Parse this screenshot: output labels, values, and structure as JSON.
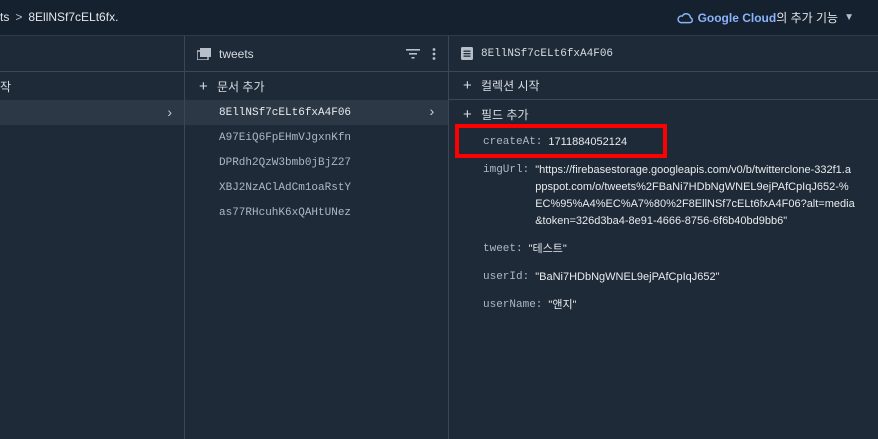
{
  "breadcrumb": {
    "part1": "ts",
    "part2": "8EllNSf7cELt6fx."
  },
  "topbar": {
    "brand": "Google Cloud",
    "suffix": "의 추가 기능"
  },
  "panel1": {
    "add_label": "작"
  },
  "panel2": {
    "title": "tweets",
    "add_label": "문서 추가",
    "documents": [
      "8EllNSf7cELt6fxA4F06",
      "A97EiQ6FpEHmVJgxnKfn",
      "DPRdh2QzW3bmb0jBjZ27",
      "XBJ2NzAClAdCm1oaRstY",
      "as77RHcuhK6xQAHtUNez"
    ]
  },
  "panel3": {
    "title": "8EllNSf7cELt6fxA4F06",
    "add_collection": "컬렉션 시작",
    "add_field": "필드 추가",
    "fields": [
      {
        "key": "createAt:",
        "value": "1711884052124"
      },
      {
        "key": "imgUrl:",
        "value": "\"https://firebasestorage.googleapis.com/v0/b/twitterclone-332f1.appspot.com/o/tweets%2FBaNi7HDbNgWNEL9ejPAfCpIqJ652-%EC%95%A4%EC%A7%80%2F8EllNSf7cELt6fxA4F06?alt=media&token=326d3ba4-8e91-4666-8756-6f6b40bd9bb6\""
      },
      {
        "key": "tweet:",
        "value": "\"테스트\""
      },
      {
        "key": "userId:",
        "value": "\"BaNi7HDbNgWNEL9ejPAfCpIqJ652\""
      },
      {
        "key": "userName:",
        "value": "\"앤지\""
      }
    ]
  },
  "colors": {
    "background": "#1e2a38",
    "highlight": "#ff0000",
    "brand": "#8ab4f8"
  }
}
